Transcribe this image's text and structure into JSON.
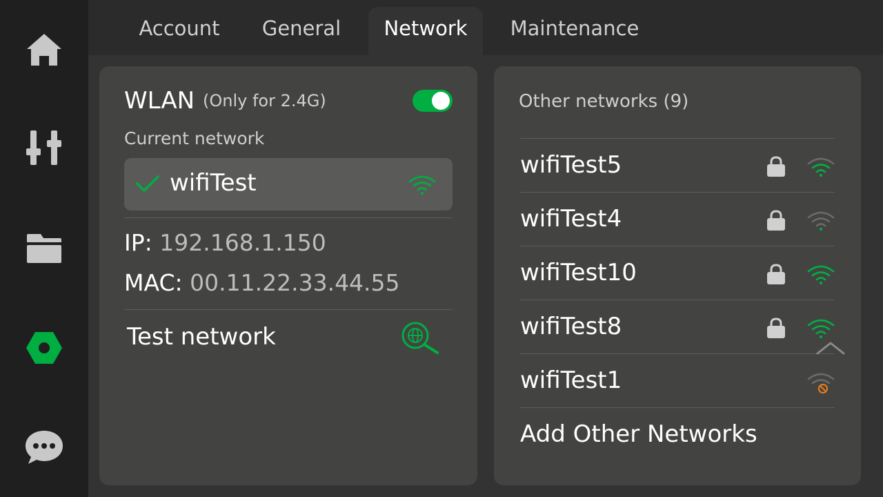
{
  "sidebar": {
    "items": [
      {
        "icon": "home-icon"
      },
      {
        "icon": "sliders-icon"
      },
      {
        "icon": "folder-icon"
      },
      {
        "icon": "settings-hex-icon",
        "active": true
      },
      {
        "icon": "chat-icon"
      }
    ]
  },
  "tabs": [
    {
      "label": "Account"
    },
    {
      "label": "General"
    },
    {
      "label": "Network",
      "active": true
    },
    {
      "label": "Maintenance"
    }
  ],
  "wlan": {
    "title": "WLAN",
    "note": "(Only for 2.4G)",
    "enabled": true,
    "current_label": "Current network",
    "current_network": "wifiTest",
    "ip_label": "IP:",
    "ip_value": "192.168.1.150",
    "mac_label": "MAC:",
    "mac_value": "00.11.22.33.44.55",
    "test_label": "Test network"
  },
  "other": {
    "label": "Other networks (9)",
    "networks": [
      {
        "name": "wifiTest5",
        "locked": true,
        "signal": "weak"
      },
      {
        "name": "wifiTest4",
        "locked": true,
        "signal": "very-weak"
      },
      {
        "name": "wifiTest10",
        "locked": true,
        "signal": "strong"
      },
      {
        "name": "wifiTest8",
        "locked": true,
        "signal": "strong"
      },
      {
        "name": "wifiTest1",
        "locked": false,
        "signal": "unavailable"
      }
    ],
    "add_label": "Add Other Networks"
  },
  "colors": {
    "accent": "#00ae42",
    "sidebar_bg": "#1f1f1f",
    "panel_bg": "#434441",
    "page_bg": "#333333"
  }
}
